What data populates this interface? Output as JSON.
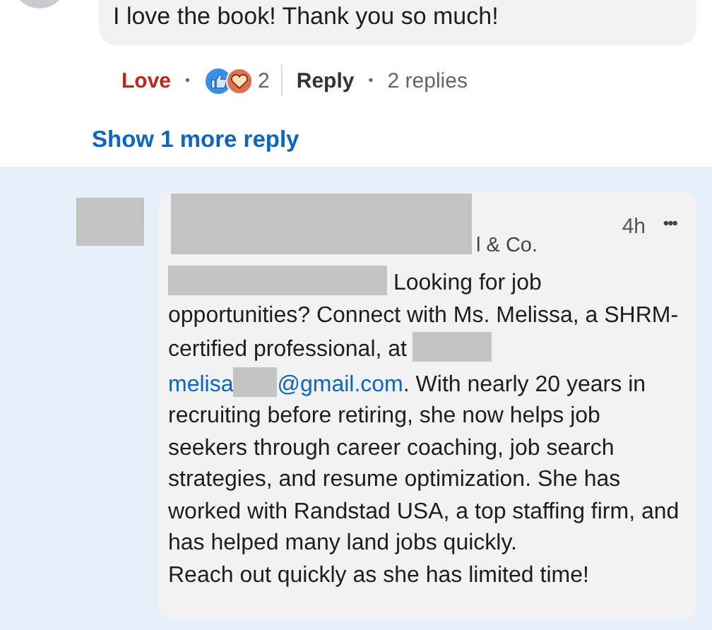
{
  "top_comment": {
    "text": "I love the book! Thank you so much!",
    "reaction": {
      "label": "Love",
      "selected": true
    },
    "reaction_count": "2",
    "reply_label": "Reply",
    "replies": "2 replies",
    "separator": "•"
  },
  "show_more": "Show 1 more reply",
  "reply": {
    "subtitle_visible": "l & Co.",
    "time": "4h",
    "menu": "•••",
    "body": [
      {
        "kind": "redacted"
      },
      {
        "kind": "text",
        "text": " Looking for job opportunities? Connect with Ms. Melissa, a SHRM-certified professional, at "
      },
      {
        "kind": "redacted"
      },
      {
        "kind": "email",
        "user": "melisa",
        "domain": "@gmail.com"
      },
      {
        "kind": "text",
        "text": ". With nearly 20 years in recruiting before retiring, she now helps job seekers through career coaching, job search strategies, and resume optimization. She has worked with Randstad USA, a top staffing firm, and has helped many land jobs quickly."
      }
    ],
    "closing": "Reach out quickly as she has limited time!"
  }
}
